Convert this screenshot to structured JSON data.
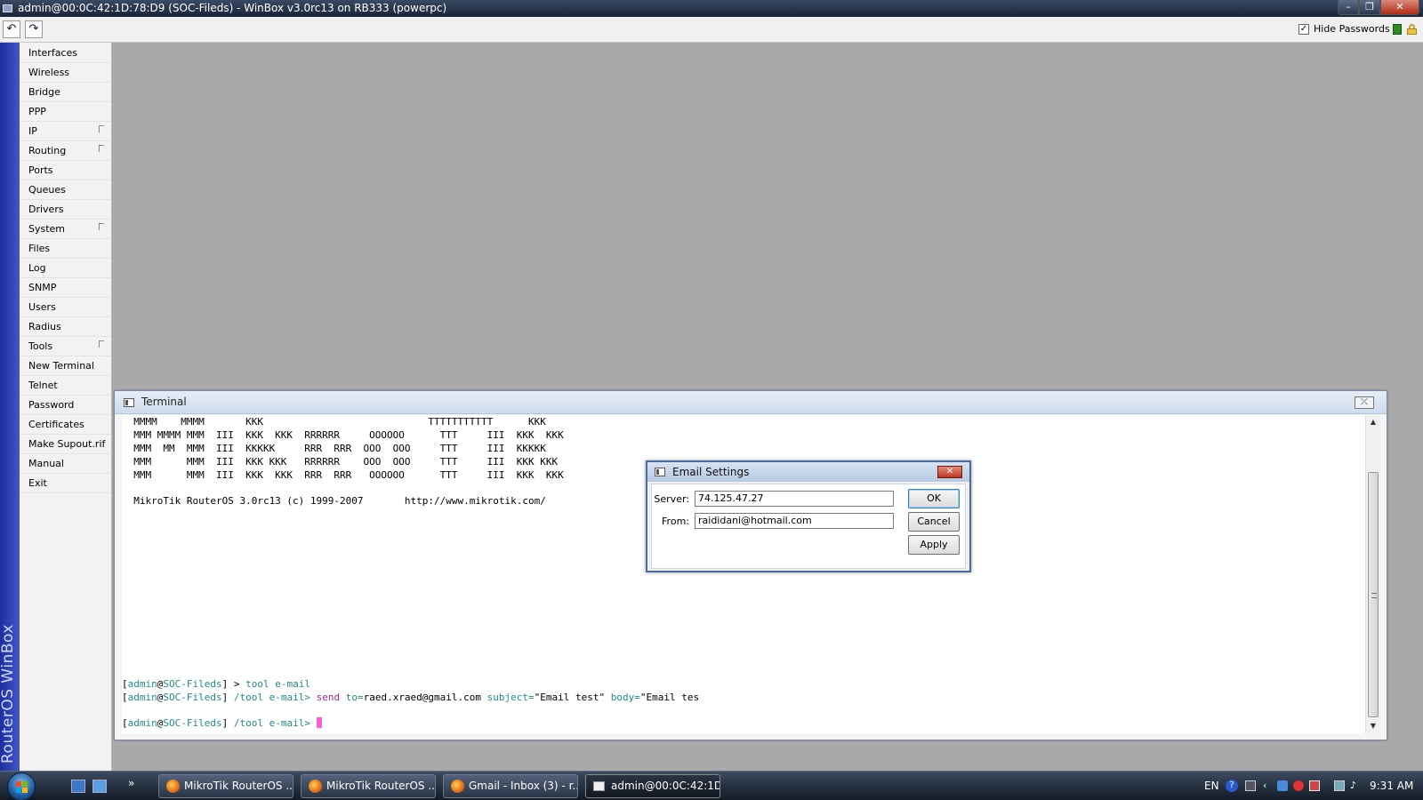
{
  "window": {
    "title": "admin@00:0C:42:1D:78:D9 (SOC-Fileds) - WinBox v3.0rc13 on RB333 (powerpc)"
  },
  "toolbar": {
    "hide_passwords_label": "Hide Passwords",
    "hide_passwords_checked": true
  },
  "brand": "RouterOS WinBox",
  "menu": {
    "items": [
      {
        "label": "Interfaces",
        "submenu": false
      },
      {
        "label": "Wireless",
        "submenu": false
      },
      {
        "label": "Bridge",
        "submenu": false
      },
      {
        "label": "PPP",
        "submenu": false
      },
      {
        "label": "IP",
        "submenu": true
      },
      {
        "label": "Routing",
        "submenu": true
      },
      {
        "label": "Ports",
        "submenu": false
      },
      {
        "label": "Queues",
        "submenu": false
      },
      {
        "label": "Drivers",
        "submenu": false
      },
      {
        "label": "System",
        "submenu": true
      },
      {
        "label": "Files",
        "submenu": false
      },
      {
        "label": "Log",
        "submenu": false
      },
      {
        "label": "SNMP",
        "submenu": false
      },
      {
        "label": "Users",
        "submenu": false
      },
      {
        "label": "Radius",
        "submenu": false
      },
      {
        "label": "Tools",
        "submenu": true
      },
      {
        "label": "New Terminal",
        "submenu": false
      },
      {
        "label": "Telnet",
        "submenu": false
      },
      {
        "label": "Password",
        "submenu": false
      },
      {
        "label": "Certificates",
        "submenu": false
      },
      {
        "label": "Make Supout.rif",
        "submenu": false
      },
      {
        "label": "Manual",
        "submenu": false
      },
      {
        "label": "Exit",
        "submenu": false
      }
    ]
  },
  "terminal": {
    "title": "Terminal",
    "banner": [
      "  MMMM    MMMM       KKK                            TTTTTTTTTTT      KKK",
      "  MMM MMMM MMM  III  KKK  KKK  RRRRRR     OOOOOO      TTT     III  KKK  KKK",
      "  MMM  MM  MMM  III  KKKKK     RRR  RRR  OOO  OOO     TTT     III  KKKKK",
      "  MMM      MMM  III  KKK KKK   RRRRRR    OOO  OOO     TTT     III  KKK KKK",
      "  MMM      MMM  III  KKK  KKK  RRR  RRR   OOOOOO      TTT     III  KKK  KKK"
    ],
    "version_line": "  MikroTik RouterOS 3.0rc13 (c) 1999-2007       http://www.mikrotik.com/",
    "cmd1": {
      "prompt_open": "[",
      "user": "admin",
      "at": "@",
      "host": "SOC-Fileds",
      "prompt_close": "] ",
      "gt": "> ",
      "command": "tool e-mail"
    },
    "cmd2": {
      "prompt_open": "[",
      "user": "admin",
      "at": "@",
      "host": "SOC-Fileds",
      "prompt_close": "] ",
      "path": "/tool e-mail> ",
      "verb": "send ",
      "to_key": "to=",
      "to_val": "raed.xraed@gmail.com ",
      "subject_key": "subject=",
      "subject_val": "\"Email test\" ",
      "body_key": "body=",
      "body_val": "\"Email tes"
    },
    "cmd3": {
      "prompt_open": "[",
      "user": "admin",
      "at": "@",
      "host": "SOC-Fileds",
      "prompt_close": "] ",
      "path": "/tool e-mail> "
    }
  },
  "email_dialog": {
    "title": "Email Settings",
    "server_label": "Server:",
    "server_value": "74.125.47.27",
    "from_label": "From:",
    "from_value": "raididani@hotmail.com",
    "ok_label": "OK",
    "cancel_label": "Cancel",
    "apply_label": "Apply"
  },
  "taskbar": {
    "more_label": "»",
    "tasks": [
      {
        "label": "MikroTik RouterOS ...",
        "icon": "firefox-icon"
      },
      {
        "label": "MikroTik RouterOS ...",
        "icon": "firefox-icon"
      },
      {
        "label": "Gmail - Inbox (3) - r...",
        "icon": "firefox-icon"
      },
      {
        "label": "admin@00:0C:42:1D...",
        "icon": "winbox-icon"
      }
    ],
    "language": "EN",
    "help_glyph": "?",
    "clock": "9:31 AM"
  },
  "colors": {
    "brand_strip": "#2a3db0",
    "prompt_teal": "#1e8c8c",
    "command_purple": "#9a2c9a",
    "cursor_pink": "#ff5fd2"
  }
}
